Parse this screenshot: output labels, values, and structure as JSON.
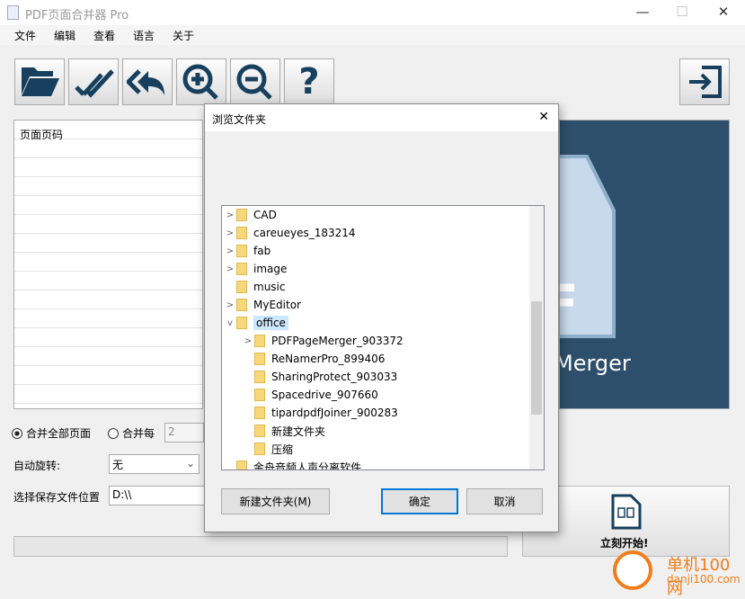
{
  "window": {
    "title": "PDF页面合并器 Pro",
    "minimize": "—",
    "maximize": "☐",
    "close": "✕"
  },
  "menu": [
    "文件",
    "编辑",
    "查看",
    "语言",
    "关于"
  ],
  "toolbar": [
    {
      "icon": "open-folder-icon"
    },
    {
      "icon": "double-check-icon"
    },
    {
      "icon": "reply-all-icon"
    },
    {
      "icon": "zoom-in-icon"
    },
    {
      "icon": "zoom-out-icon"
    },
    {
      "icon": "help-icon"
    }
  ],
  "toolbar_right": {
    "icon": "exit-icon"
  },
  "list": {
    "header": "页面页码"
  },
  "preview": {
    "text": "Merger"
  },
  "options": {
    "merge_all": "合并全部页面",
    "merge_every": "合并每",
    "merge_every_value": "2",
    "auto_rotate_label": "自动旋转:",
    "auto_rotate_value": "无",
    "save_location_label": "选择保存文件位置",
    "save_location_value": "D:\\\\"
  },
  "start_button": "立刻开始!",
  "watermark": {
    "text": "单机100网",
    "url": "danji100.com"
  },
  "dialog": {
    "title": "浏览文件夹",
    "close": "✕",
    "tree": [
      {
        "label": "CAD",
        "level": 0,
        "expander": ">"
      },
      {
        "label": "careueyes_183214",
        "level": 0,
        "expander": ">"
      },
      {
        "label": "fab",
        "level": 0,
        "expander": ">"
      },
      {
        "label": "image",
        "level": 0,
        "expander": ">"
      },
      {
        "label": "music",
        "level": 0,
        "expander": ""
      },
      {
        "label": "MyEditor",
        "level": 0,
        "expander": ">"
      },
      {
        "label": "office",
        "level": 0,
        "expander": "v",
        "selected": true
      },
      {
        "label": "PDFPageMerger_903372",
        "level": 1,
        "expander": ">"
      },
      {
        "label": "ReNamerPro_899406",
        "level": 1,
        "expander": ""
      },
      {
        "label": "SharingProtect_903033",
        "level": 1,
        "expander": ""
      },
      {
        "label": "Spacedrive_907660",
        "level": 1,
        "expander": ""
      },
      {
        "label": "tipardpdfJoiner_900283",
        "level": 1,
        "expander": ""
      },
      {
        "label": "新建文件夹",
        "level": 1,
        "expander": ""
      },
      {
        "label": "压缩",
        "level": 1,
        "expander": ""
      },
      {
        "label": "金舟音频人声分离软件",
        "level": 0,
        "expander": ""
      }
    ],
    "new_folder": "新建文件夹(M)",
    "ok": "确定",
    "cancel": "取消"
  },
  "colors": {
    "icon": "#17405e",
    "accent": "#0078d7",
    "selected": "#cce8ff"
  }
}
